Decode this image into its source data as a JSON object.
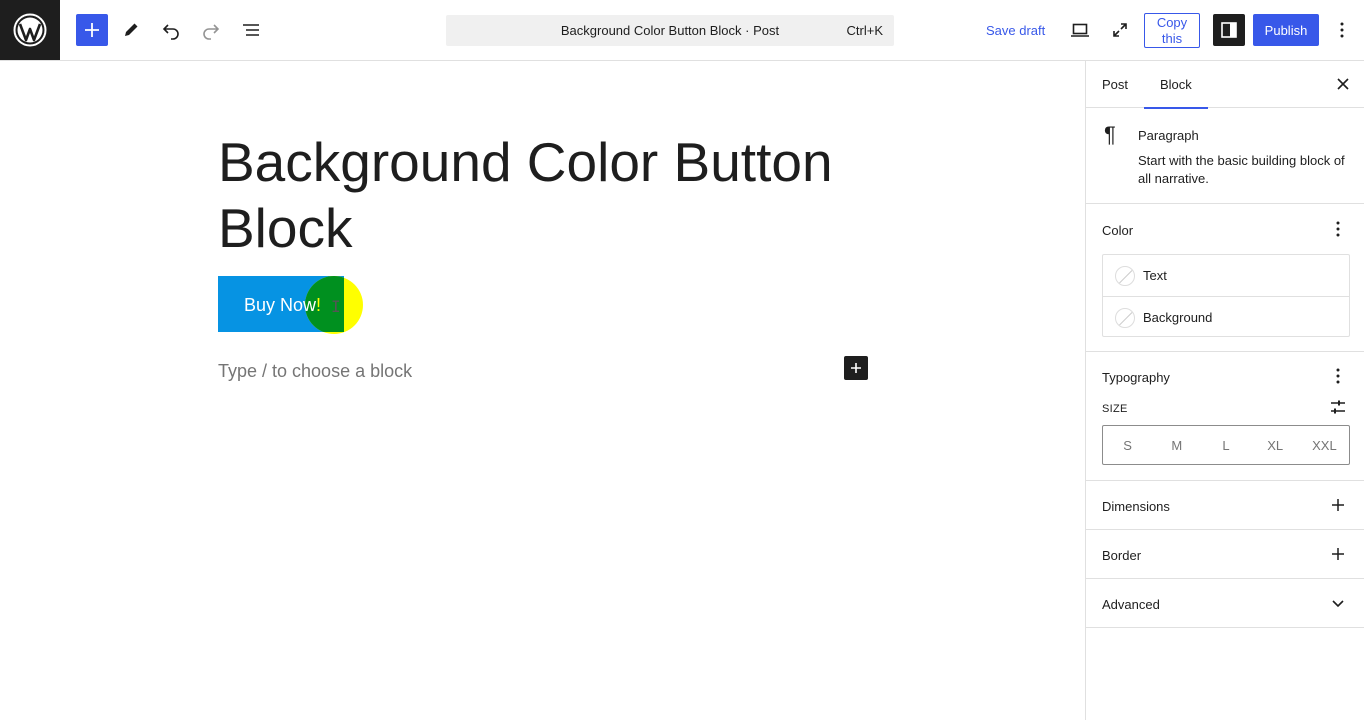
{
  "toolbar": {
    "logo_icon": "wordpress-logo-icon",
    "inserter_icon": "plus-icon",
    "tools_icon": "pencil-icon",
    "undo_icon": "undo-icon",
    "redo_icon": "redo-icon",
    "listview_icon": "list-view-icon",
    "document_title": "Background Color Button Block · Post",
    "shortcut": "Ctrl+K",
    "save_draft": "Save draft",
    "preview_icon": "laptop-icon",
    "fullscreen_icon": "fullscreen-icon",
    "copy_this": "Copy this",
    "settings_icon": "sidebar-toggle-icon",
    "publish": "Publish",
    "options_icon": "more-vertical-icon"
  },
  "canvas": {
    "post_title": "Background Color Button Block",
    "button_label_main": "Buy Now",
    "button_label_tail": "!",
    "button_bg": "#0693e3",
    "placeholder": "Type / to choose a block"
  },
  "sidebar": {
    "tabs": [
      {
        "label": "Post",
        "active": false
      },
      {
        "label": "Block",
        "active": true
      }
    ],
    "block": {
      "title": "Paragraph",
      "description": "Start with the basic building block of all narrative."
    },
    "color": {
      "title": "Color",
      "items": [
        "Text",
        "Background"
      ]
    },
    "typography": {
      "title": "Typography",
      "size_label": "SIZE",
      "sizes": [
        "S",
        "M",
        "L",
        "XL",
        "XXL"
      ]
    },
    "dimensions": {
      "title": "Dimensions"
    },
    "border": {
      "title": "Border"
    },
    "advanced": {
      "title": "Advanced"
    }
  },
  "colors": {
    "accent": "#3858e9",
    "dark": "#1e1e1e",
    "cursor_highlight": "#ffff00"
  }
}
